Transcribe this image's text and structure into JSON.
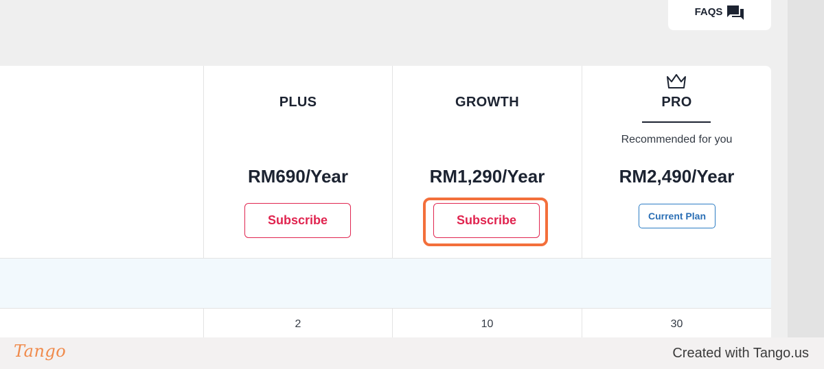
{
  "header": {
    "faqs_label": "FAQS"
  },
  "plans": [
    {
      "name": "PLUS",
      "price": "RM690/Year",
      "action": "Subscribe",
      "row_value": "2"
    },
    {
      "name": "GROWTH",
      "price": "RM1,290/Year",
      "action": "Subscribe",
      "row_value": "10"
    },
    {
      "name": "PRO",
      "price": "RM2,490/Year",
      "recommended": "Recommended for you",
      "action": "Current Plan",
      "row_value": "30"
    }
  ],
  "footer": {
    "logo": "Tango",
    "credit": "Created with Tango.us"
  },
  "colors": {
    "accent_red": "#e0244f",
    "highlight_orange": "#f36f3b",
    "current_plan_blue": "#2b7cc4",
    "section_band": "#f2f9fd"
  }
}
